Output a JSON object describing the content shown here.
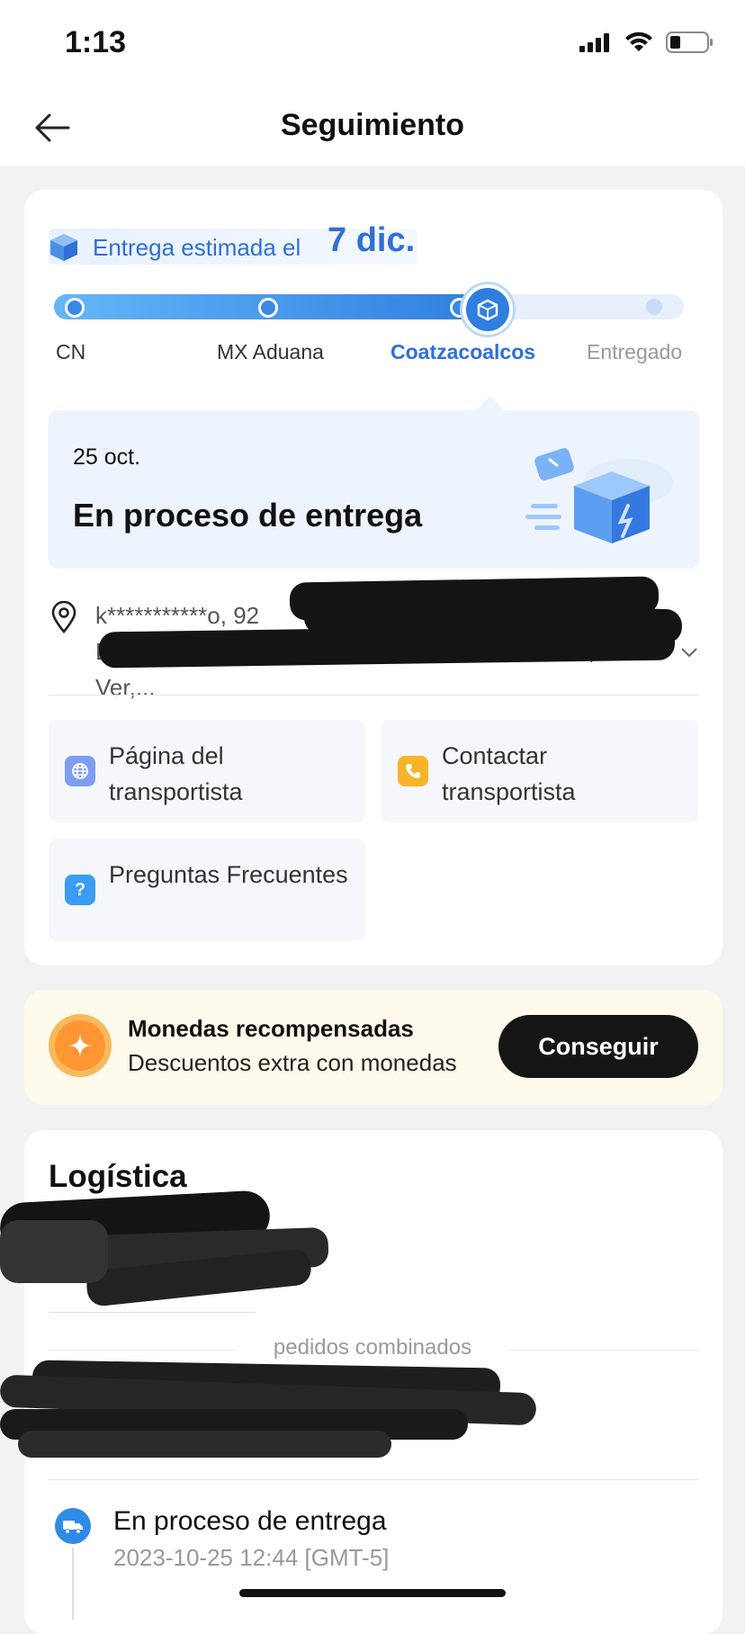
{
  "status_bar": {
    "time": "1:13"
  },
  "header": {
    "title": "Seguimiento"
  },
  "tracking": {
    "eta_label": "Entrega estimada el",
    "eta_date": "7 dic.",
    "steps": [
      "CN",
      "MX Aduana",
      "Coatzacoalcos",
      "Entregado"
    ],
    "current_step": 3,
    "step_colors": {
      "done": "#333333",
      "current": "#2f6fd6",
      "future": "#999999"
    }
  },
  "status_card": {
    "date": "25 oct.",
    "title": "En proceso de entrega"
  },
  "address": {
    "line1": "k***********o,  92",
    "line2": "Bautista 1309, Playa Sol, 96518 Coatzacoalcos, Ver,..."
  },
  "actions": {
    "carrier_page": "Página del transportista",
    "contact_carrier": "Contactar transportista",
    "faq": "Preguntas Frecuentes"
  },
  "coins": {
    "title": "Monedas recompensadas",
    "subtitle": "Descuentos extra con monedas",
    "button": "Conseguir"
  },
  "logistics": {
    "title": "Logística",
    "combined_orders": "pedidos combinados",
    "events": [
      {
        "title": "En proceso de entrega",
        "time": "2023-10-25 12:44 [GMT-5]"
      }
    ]
  },
  "colors": {
    "accent": "#2f6fd6",
    "coin": "#ff9631",
    "button_dark": "#151515"
  }
}
